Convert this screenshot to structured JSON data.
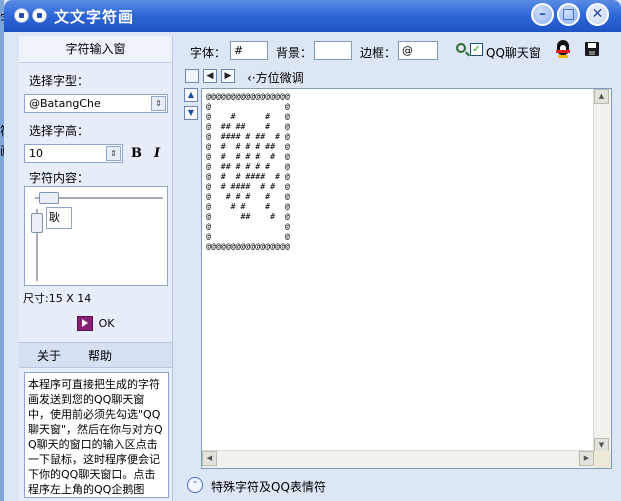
{
  "window": {
    "title": "文文字符画"
  },
  "desktop": {
    "chars": [
      "字",
      "符",
      "画"
    ]
  },
  "left": {
    "panel_title": "字符输入窗",
    "font_label": "选择字型：",
    "font_value": "@BatangChe",
    "height_label": "选择字高：",
    "height_value": "10",
    "bold_label": "B",
    "italic_label": "I",
    "content_label": "字符内容：",
    "content_value": "耿",
    "size_text": "尺寸:15 X 14",
    "ok_label": "OK",
    "about_label": "关于",
    "help_label": "帮助",
    "help_text": "本程序可直接把生成的字符画发送到您的QQ聊天窗中，使用前必须先勾选\"QQ聊天窗\"，然后在你与对方QQ聊天的窗口的输入区点击一下鼠标，这时程序便会记下你的QQ聊天窗口。点击程序左上角的QQ企鹅图案，在下拉的菜单中可"
  },
  "toolbar": {
    "glyph_label": "字体：",
    "glyph_value": "#",
    "bg_label": "背景：",
    "bg_value": "",
    "border_label": "边框：",
    "border_value": "@",
    "qq_checked": true,
    "qq_label": "QQ聊天窗"
  },
  "nav": {
    "fine_tune_label": "‹·方位微调"
  },
  "canvas": {
    "art": "@@@@@@@@@@@@@@@@@\n@               @\n@    #      #   @\n@  ## ##    #   @\n@  #### # ##  # @\n@  #  # # # ##  @\n@  #  # # #  #  @\n@  ## # # # #   @\n@  #  # ####  # @\n@  # ####  # #  @\n@   # # #   #   @\n@    # #    #   @\n@      ##    #  @\n@               @\n@               @\n@@@@@@@@@@@@@@@@@"
  },
  "bottom": {
    "label": "特殊字符及QQ表情符"
  },
  "icons": {
    "system": "system-menu-icon",
    "pin": "pin-icon",
    "minimize": "minimize-icon",
    "maximize": "maximize-icon",
    "close": "close-icon",
    "zoom": "magnifier-icon",
    "qq": "qq-penguin-icon",
    "save": "floppy-disk-icon",
    "ok": "play-icon",
    "expand": "double-chevron-up-icon"
  },
  "colors": {
    "titlebar": "#2f68d8",
    "panel": "#e8eef9",
    "accent": "#8a1f78"
  }
}
